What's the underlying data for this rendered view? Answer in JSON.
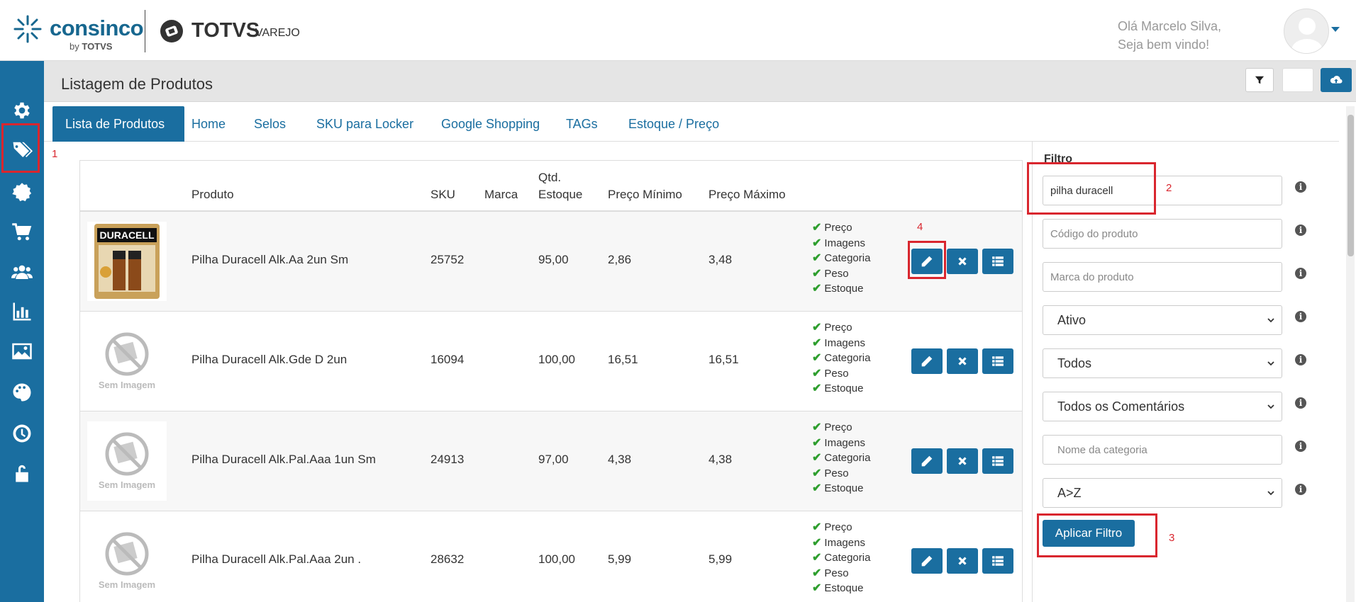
{
  "header": {
    "brand_name": "consinco",
    "brand_by": "by",
    "brand_by_company": "TOTVS",
    "partner_name": "TOTVS",
    "partner_sub": "VAREJO",
    "greeting_line1": "Olá Marcelo Silva,",
    "greeting_line2": "Seja bem vindo!"
  },
  "sidebar": {
    "items": [
      {
        "icon": "gear-icon"
      },
      {
        "icon": "tags-icon"
      },
      {
        "icon": "badge-icon"
      },
      {
        "icon": "cart-icon"
      },
      {
        "icon": "users-icon"
      },
      {
        "icon": "bar-chart-icon"
      },
      {
        "icon": "image-icon"
      },
      {
        "icon": "palette-icon"
      },
      {
        "icon": "clock-icon"
      },
      {
        "icon": "unlock-icon"
      }
    ]
  },
  "page": {
    "title": "Listagem de Produtos"
  },
  "tabs": [
    {
      "label": "Lista de Produtos",
      "active": true
    },
    {
      "label": "Home"
    },
    {
      "label": "Selos"
    },
    {
      "label": "SKU para Locker"
    },
    {
      "label": "Google Shopping"
    },
    {
      "label": "TAGs"
    },
    {
      "label": "Estoque / Preço"
    }
  ],
  "annotations": {
    "n1": "1",
    "n2": "2",
    "n3": "3",
    "n4": "4"
  },
  "table": {
    "headers": {
      "produto": "Produto",
      "sku": "SKU",
      "marca": "Marca",
      "qtd_line1": "Qtd.",
      "qtd_line2": "Estoque",
      "preco_min": "Preço Mínimo",
      "preco_max": "Preço Máximo"
    },
    "no_image_text": "Sem Imagem",
    "product_image_text": "DURACELL",
    "checks": [
      "Preço",
      "Imagens",
      "Categoria",
      "Peso",
      "Estoque"
    ],
    "rows": [
      {
        "produto": "Pilha Duracell Alk.Aa 2un Sm",
        "sku": "25752",
        "marca": "",
        "qtd": "95,00",
        "preco_min": "2,86",
        "preco_max": "3,48",
        "has_image": true
      },
      {
        "produto": "Pilha Duracell Alk.Gde D 2un",
        "sku": "16094",
        "marca": "",
        "qtd": "100,00",
        "preco_min": "16,51",
        "preco_max": "16,51",
        "has_image": false
      },
      {
        "produto": "Pilha Duracell Alk.Pal.Aaa 1un Sm",
        "sku": "24913",
        "marca": "",
        "qtd": "97,00",
        "preco_min": "4,38",
        "preco_max": "4,38",
        "has_image": false
      },
      {
        "produto": "Pilha Duracell Alk.Pal.Aaa 2un .",
        "sku": "28632",
        "marca": "",
        "qtd": "100,00",
        "preco_min": "5,99",
        "preco_max": "5,99",
        "has_image": false
      }
    ]
  },
  "filter": {
    "title": "Filtro",
    "search_value": "pilha duracell",
    "codigo_placeholder": "Código do produto",
    "marca_placeholder": "Marca do produto",
    "status_selected": "Ativo",
    "tipo_selected": "Todos",
    "comentarios_selected": "Todos os Comentários",
    "categoria_placeholder": "Nome da categoria",
    "ordem_selected": "A>Z",
    "apply_label": "Aplicar Filtro"
  },
  "colors": {
    "primary": "#1a6ea0",
    "annotation_red": "#d9262e",
    "check_green": "#2e9e2e"
  }
}
